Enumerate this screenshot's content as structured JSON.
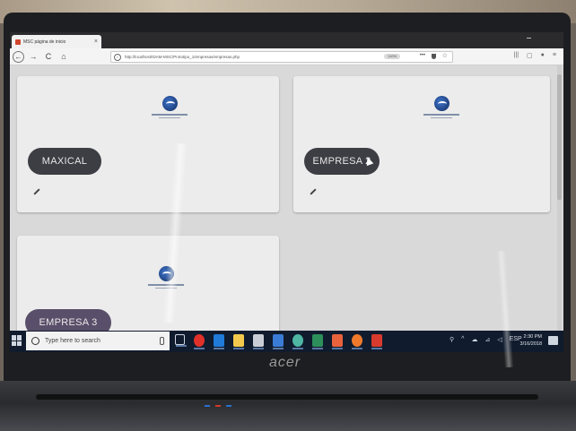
{
  "browser": {
    "tab_title": "MSC página de inicio",
    "tab_close": "×",
    "url": "http://localhost/IDAM-MSC/Prototipo_1/empresas/empresas.php",
    "zoom": "110%",
    "page_actions": "•••",
    "star": "☆"
  },
  "nav": {
    "back": "←",
    "forward": "→",
    "reload": "C",
    "home": "⌂"
  },
  "toolbar_icons": [
    "library-icon",
    "sidebar-icon",
    "account-icon",
    "menu-icon"
  ],
  "toolbar_glyphs": [
    "|||",
    "▢",
    "●",
    "≡"
  ],
  "cards": [
    {
      "label": "MAXICAL"
    },
    {
      "label": "EMPRESA 2"
    },
    {
      "label": "EMPRESA 3"
    }
  ],
  "taskbar": {
    "search_placeholder": "Type here to search",
    "tray_glyphs": [
      "⚲",
      "^",
      "☁",
      "⊿",
      "◁",
      "ESP"
    ],
    "time": "2:30 PM",
    "date": "3/16/2018"
  },
  "laptop": {
    "brand": "acer"
  },
  "colors": {
    "pill": "#3d3d44",
    "card": "#ececec",
    "taskbar": "#101b2d",
    "logo_blue": "#1c3d7a"
  }
}
